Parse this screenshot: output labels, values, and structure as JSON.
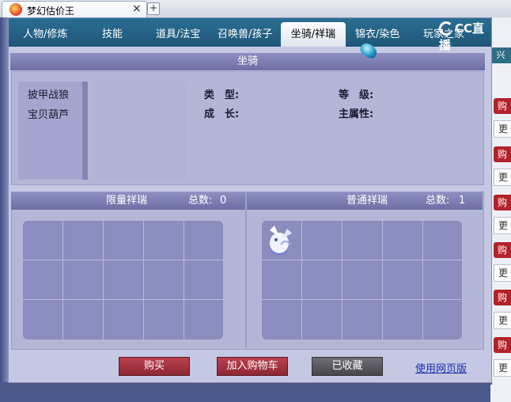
{
  "browser": {
    "tab_title": "梦幻估价王",
    "close_glyph": "×",
    "new_tab_glyph": "+"
  },
  "nav": {
    "tabs": [
      {
        "label": "人物/修炼"
      },
      {
        "label": "技能"
      },
      {
        "label": "道具/法宝"
      },
      {
        "label": "召唤兽/孩子"
      },
      {
        "label": "坐骑/祥瑞",
        "active": true
      },
      {
        "label": "锦衣/染色"
      },
      {
        "label": "玩家之家"
      }
    ],
    "watermark": "CC直播"
  },
  "mount_section": {
    "title": "坐骑",
    "list": [
      "披甲战狼",
      "宝贝葫芦"
    ],
    "type_label": "类　型:",
    "level_label": "等　级:",
    "growth_label": "成　长:",
    "attr_label": "主属性:"
  },
  "limited_section": {
    "title": "限量祥瑞",
    "total_label": "总数:",
    "total_value": "0"
  },
  "normal_section": {
    "title": "普通祥瑞",
    "total_label": "总数:",
    "total_value": "1"
  },
  "actions": {
    "buy": "购买",
    "add_cart": "加入购物车",
    "favorited": "已收藏",
    "web_link": "使用网页版"
  },
  "right_strip": {
    "top": "兴",
    "items": [
      "购",
      "更",
      "购",
      "更",
      "购",
      "更",
      "购",
      "更",
      "购",
      "更",
      "购",
      "更"
    ]
  },
  "colors": {
    "nav_bg": "#2a6e92",
    "panel_bg": "#c5c8e3",
    "button_red": "#9e2f3c",
    "button_gray": "#55565c"
  }
}
